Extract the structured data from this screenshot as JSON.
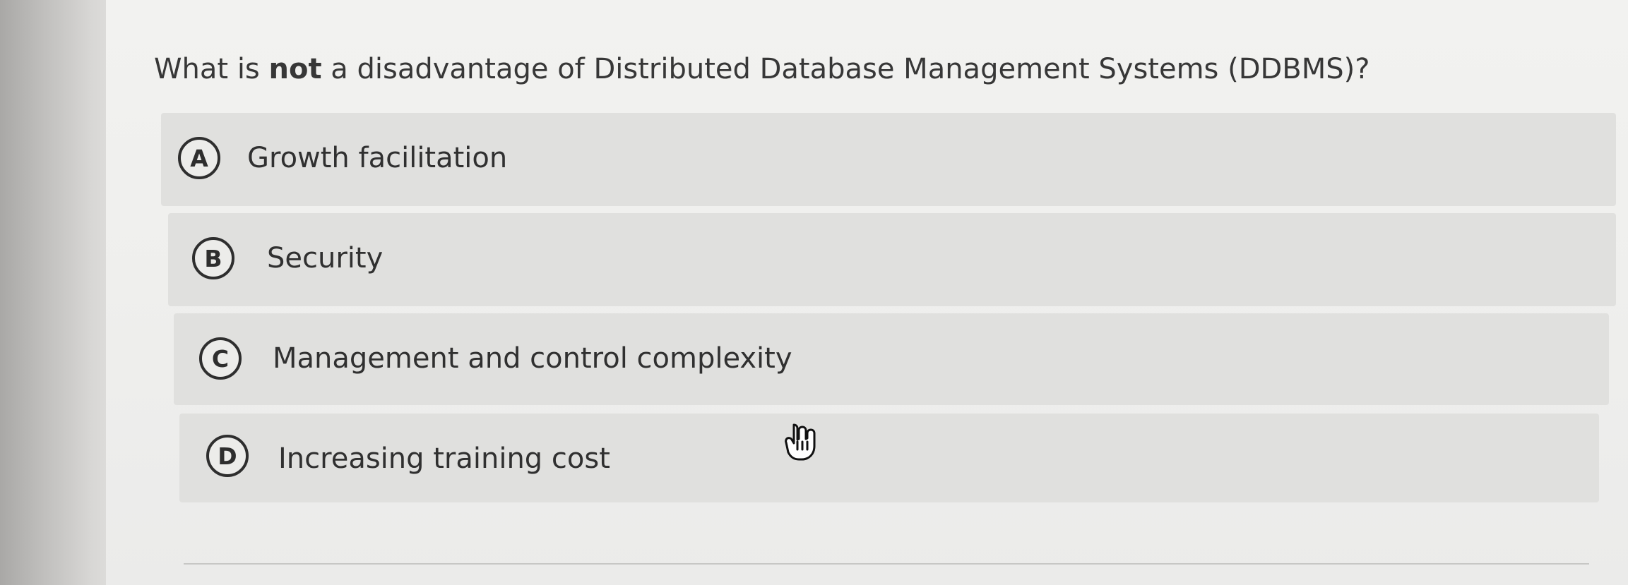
{
  "question": {
    "before_bold": "What is ",
    "bold_word": "not",
    "after_bold": " a disadvantage of Distributed Database Management Systems (DDBMS)?"
  },
  "answers": [
    {
      "letter": "A",
      "text": "Growth facilitation"
    },
    {
      "letter": "B",
      "text": "Security"
    },
    {
      "letter": "C",
      "text": "Management and control complexity"
    },
    {
      "letter": "D",
      "text": "Increasing training cost"
    }
  ],
  "icons": {
    "cursor": "hand-pointer-icon"
  },
  "colors": {
    "background": "#efefed",
    "option_background": "#e0e0de",
    "text": "#303030",
    "badge_border": "#2e2e2e"
  }
}
